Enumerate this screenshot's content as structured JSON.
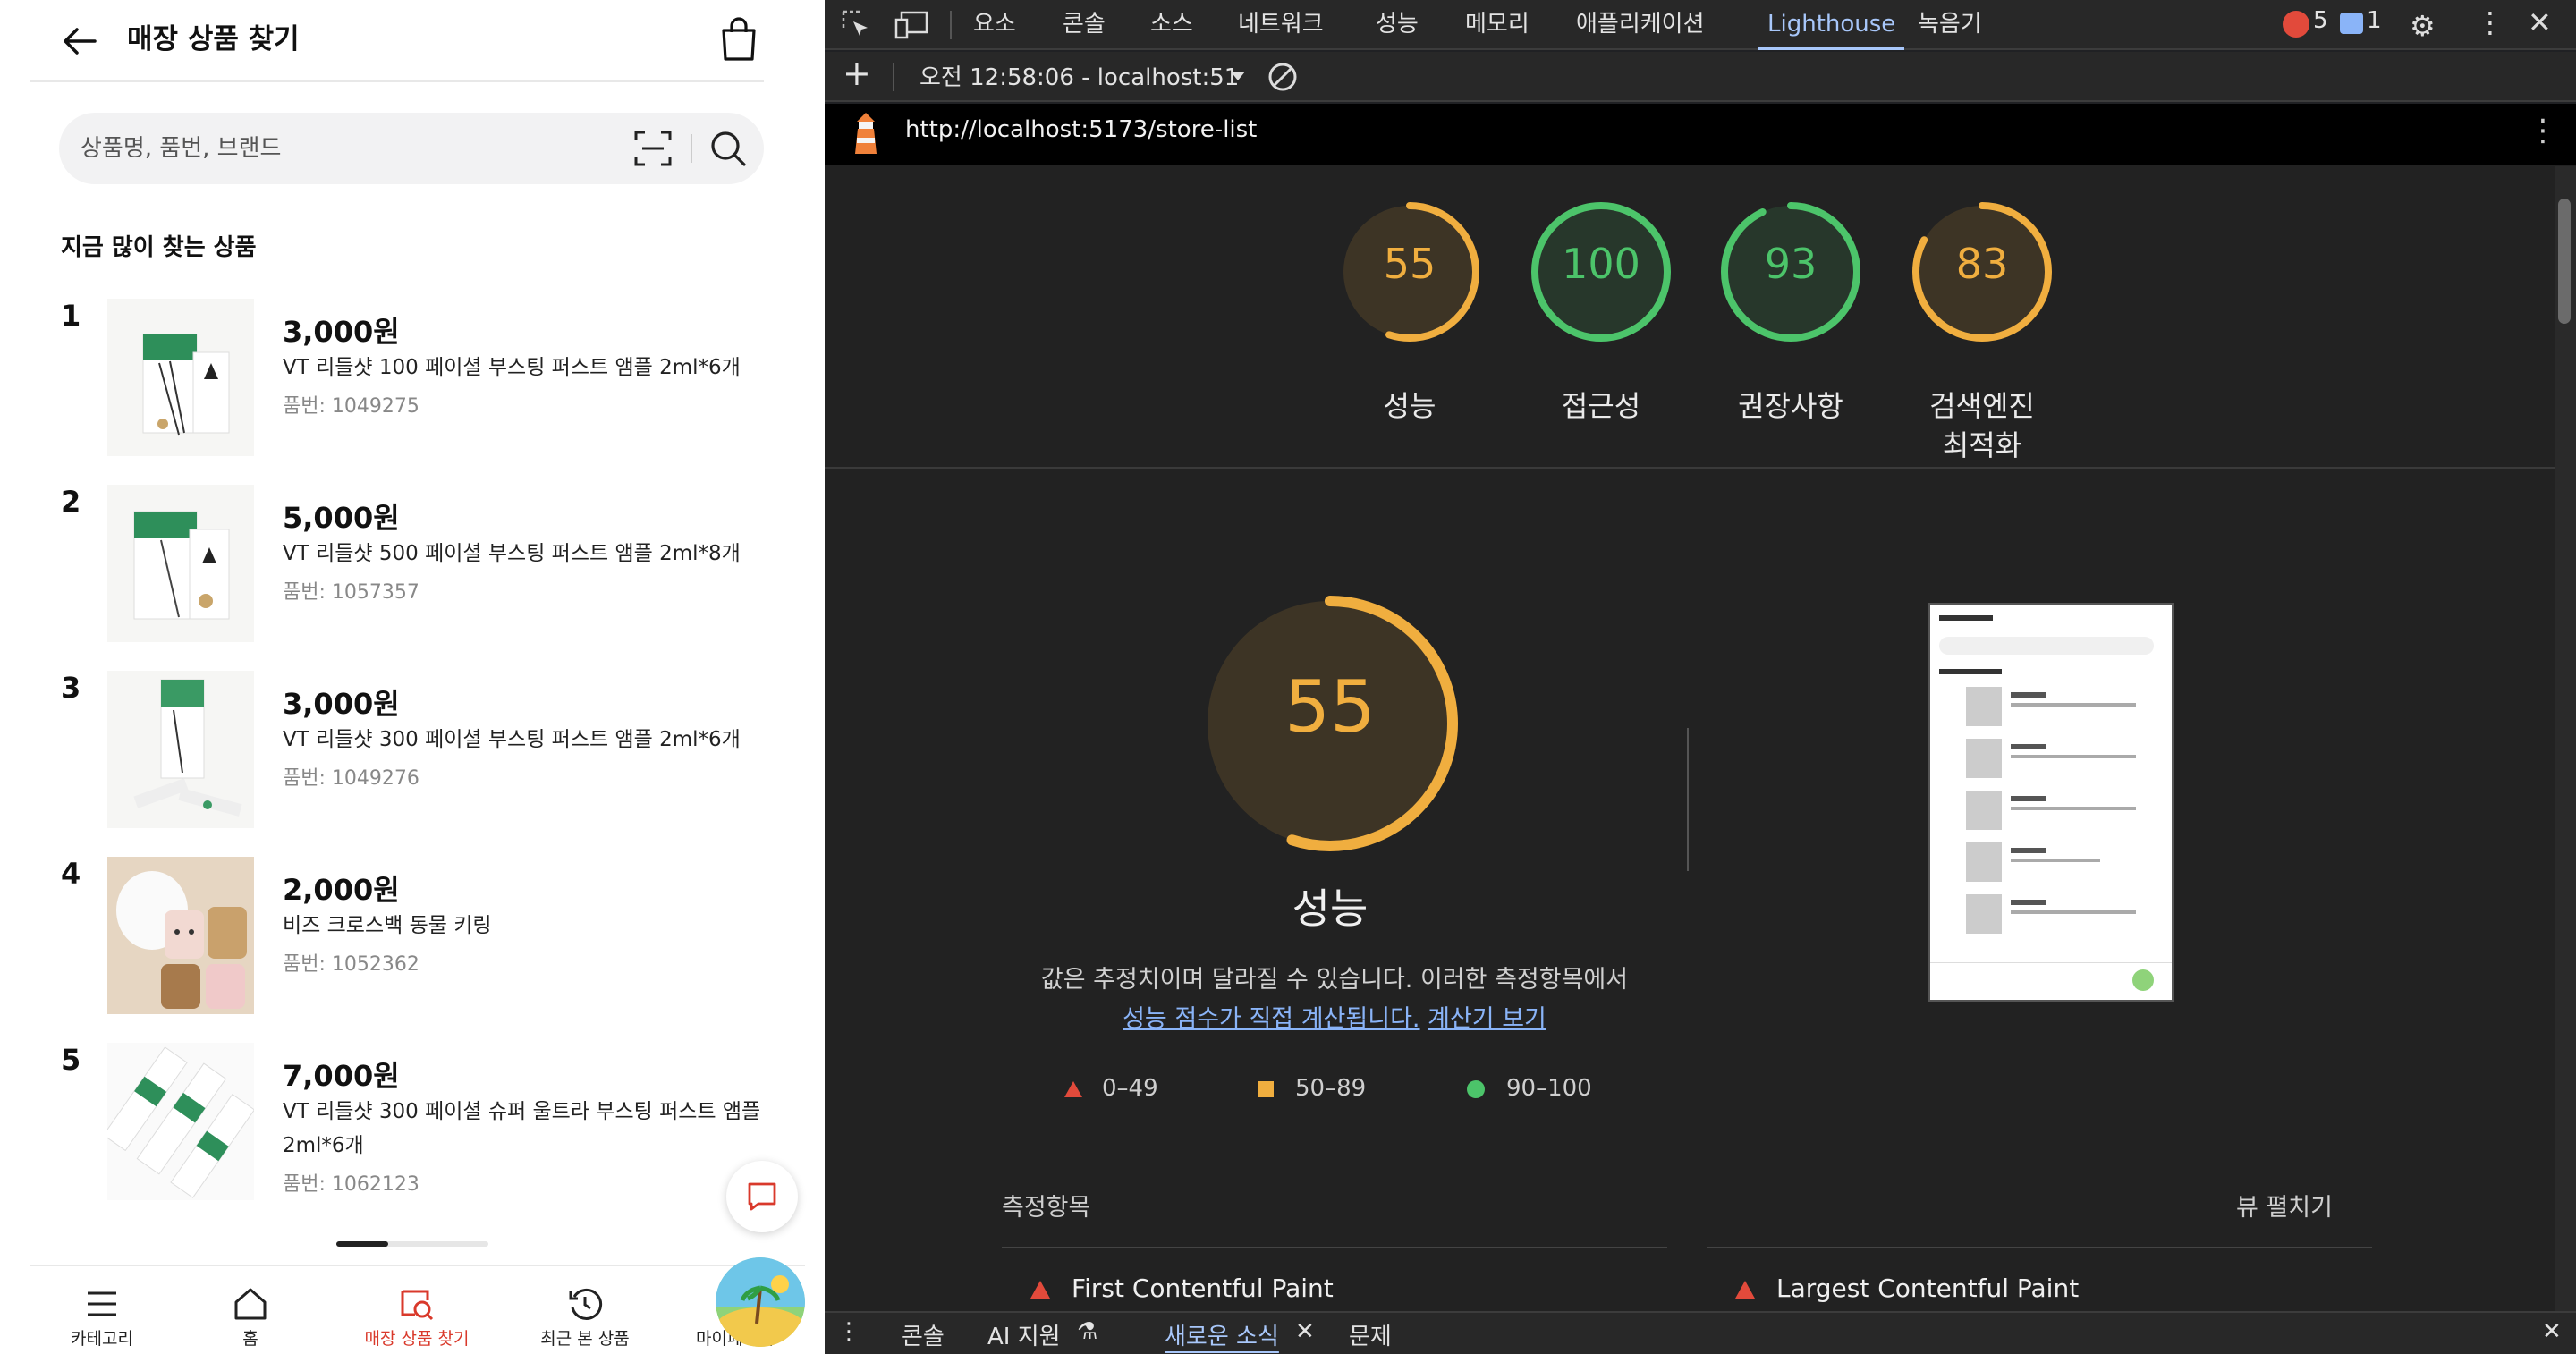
{
  "app": {
    "header": {
      "title": "매장 상품 찾기"
    },
    "search": {
      "placeholder": "상품명, 품번, 브랜드"
    },
    "section_title": "지금 많이 찾는 상품",
    "products": [
      {
        "rank": "1",
        "price": "3,000원",
        "name": "VT 리들샷 100 페이셜 부스팅 퍼스트 앰플 2ml*6개",
        "code": "품번: 1049275"
      },
      {
        "rank": "2",
        "price": "5,000원",
        "name": "VT 리들샷 500 페이셜 부스팅 퍼스트 앰플 2ml*8개",
        "code": "품번: 1057357"
      },
      {
        "rank": "3",
        "price": "3,000원",
        "name": "VT 리들샷 300 페이셜 부스팅 퍼스트 앰플 2ml*6개",
        "code": "품번: 1049276"
      },
      {
        "rank": "4",
        "price": "2,000원",
        "name": "비즈 크로스백 동물 키링",
        "code": "품번: 1052362"
      },
      {
        "rank": "5",
        "price": "7,000원",
        "name": "VT 리들샷 300 페이셜 슈퍼 울트라 부스팅 퍼스트 앰플 2ml*6개",
        "code": "품번: 1062123"
      }
    ],
    "bottom_nav": [
      {
        "label": "카테고리",
        "icon": "menu-icon"
      },
      {
        "label": "홈",
        "icon": "home-icon"
      },
      {
        "label": "매장 상품 찾기",
        "icon": "store-search-icon",
        "active": true
      },
      {
        "label": "최근 본 상품",
        "icon": "history-icon"
      },
      {
        "label": "마이페이지",
        "icon": "avatar"
      }
    ],
    "accent_color": "#d9392b"
  },
  "devtools": {
    "tabs": [
      "요소",
      "콘솔",
      "소스",
      "네트워크",
      "성능",
      "메모리",
      "애플리케이션",
      "Lighthouse",
      "녹음기"
    ],
    "active_tab": "Lighthouse",
    "error_count": "5",
    "message_count": "1",
    "report_selector": "오전 12:58:06 - localhost:51",
    "url": "http://localhost:5173/store-list",
    "scores": [
      {
        "value": 55,
        "label": "성능",
        "color": "#f0ae3f"
      },
      {
        "value": 100,
        "label": "접근성",
        "color": "#4cc46a"
      },
      {
        "value": 93,
        "label": "권장사항",
        "color": "#4cc46a"
      },
      {
        "value": 83,
        "label": "검색엔진\n최적화",
        "color": "#f0ae3f"
      }
    ],
    "performance": {
      "score": "55",
      "title": "성능",
      "desc_text": "값은 추정치이며 달라질 수 있습니다. 이러한 측정항목에서",
      "link1": "성능 점수가 직접 계산됩니다.",
      "link2": "계산기 보기"
    },
    "legend": [
      {
        "range": "0–49",
        "color": "#e24a3b"
      },
      {
        "range": "50–89",
        "color": "#f0ae3f"
      },
      {
        "range": "90–100",
        "color": "#4cc46a"
      }
    ],
    "metrics_heading": "측정항목",
    "expand_label": "뷰 펼치기",
    "metrics": [
      "First Contentful Paint",
      "Largest Contentful Paint"
    ],
    "drawer_tabs": [
      "콘솔",
      "AI 지원",
      "새로운 소식",
      "문제"
    ],
    "drawer_active": "새로운 소식"
  }
}
